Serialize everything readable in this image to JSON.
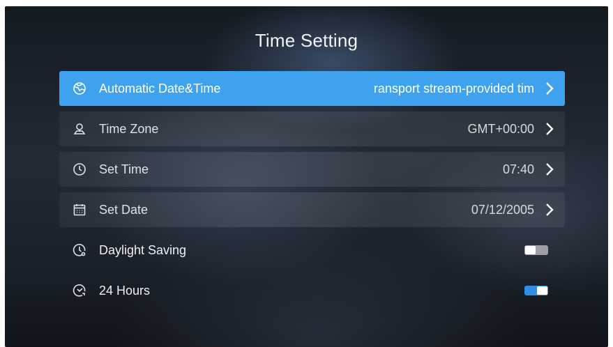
{
  "screen": {
    "title": "Time Setting",
    "accent_color": "#3ea2ee"
  },
  "rows": [
    {
      "label": "Automatic Date&Time",
      "value": "ransport stream-provided tim",
      "icon": "globe-icon",
      "selected": true,
      "control": "chevron"
    },
    {
      "label": "Time Zone",
      "value": "GMT+00:00",
      "icon": "location-pin-icon",
      "selected": false,
      "control": "chevron"
    },
    {
      "label": "Set Time",
      "value": "07:40",
      "icon": "clock-icon",
      "selected": false,
      "control": "chevron"
    },
    {
      "label": "Set Date",
      "value": "07/12/2005",
      "icon": "calendar-icon",
      "selected": false,
      "control": "chevron"
    },
    {
      "label": "Daylight Saving",
      "icon": "daylight-clock-icon",
      "selected": false,
      "control": "toggle",
      "toggle_on": false
    },
    {
      "label": "24 Hours",
      "icon": "24h-clock-icon",
      "selected": false,
      "control": "toggle",
      "toggle_on": true
    }
  ]
}
